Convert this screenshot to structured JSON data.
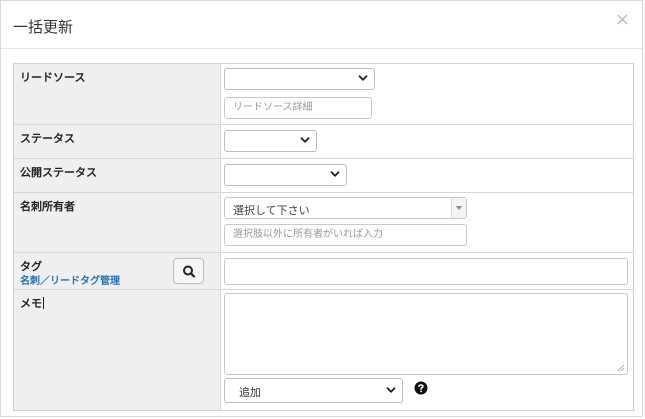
{
  "dialog": {
    "title": "一括更新",
    "close_label": "×"
  },
  "rows": {
    "lead_source": {
      "label": "リードソース",
      "select_value": "",
      "detail_placeholder": "リードソース詳細"
    },
    "status": {
      "label": "ステータス",
      "select_value": ""
    },
    "public_status": {
      "label": "公開ステータス",
      "select_value": ""
    },
    "card_owner": {
      "label": "名刺所有者",
      "select_value": "選択して下さい",
      "other_placeholder": "選択肢以外に所有者がいれば入力"
    },
    "tag": {
      "label": "タグ",
      "manage_link": "名刺／リードタグ管理",
      "input_value": ""
    },
    "memo": {
      "label": "メモ",
      "textarea_value": "",
      "mode_select_value": "追加"
    }
  },
  "icons": {
    "search": "search-icon",
    "help": "question-circle-icon",
    "chevron": "chevron-down-icon",
    "close": "close-icon"
  },
  "colors": {
    "label_bg": "#efefef",
    "link": "#1f72b8",
    "border": "#d6d6d6"
  }
}
